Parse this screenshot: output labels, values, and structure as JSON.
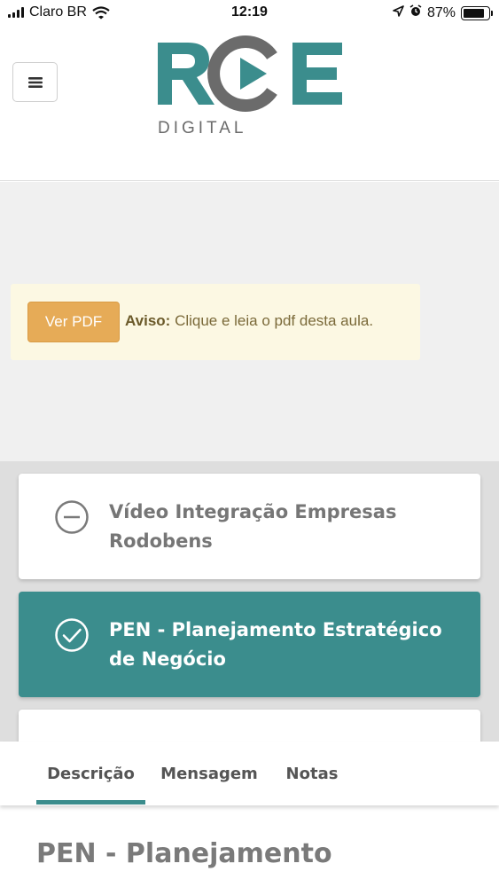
{
  "status_bar": {
    "carrier": "Claro BR",
    "time": "12:19",
    "battery": "87%",
    "battery_level": 0.87
  },
  "header": {
    "logo_main": "RCE",
    "logo_sub": "DIGITAL",
    "colors": {
      "teal": "#3b8d8d",
      "gray": "#6b6b6b"
    }
  },
  "notice": {
    "button_label": "Ver PDF",
    "label": "Aviso:",
    "message": "Clique e leia o pdf desta aula."
  },
  "lessons": [
    {
      "title": "Vídeo Integração Empresas Rodobens",
      "status": "minus-circle-icon",
      "active": false
    },
    {
      "title": "PEN - Planejamento Estratégico de Negócio",
      "status": "check-circle-icon",
      "active": true
    }
  ],
  "tabs": [
    {
      "label": "Descrição",
      "active": true
    },
    {
      "label": "Mensagem",
      "active": false
    },
    {
      "label": "Notas",
      "active": false
    }
  ],
  "page_heading": "PEN - Planejamento"
}
